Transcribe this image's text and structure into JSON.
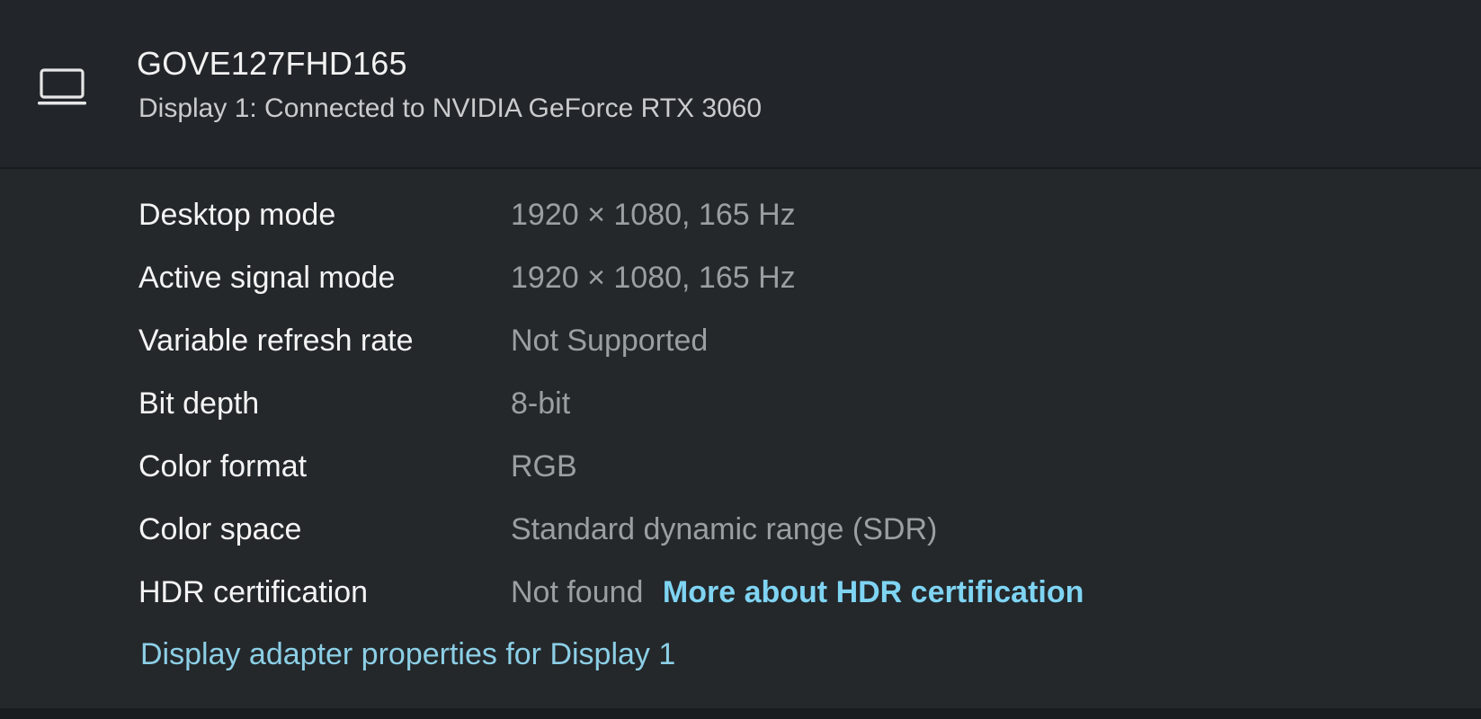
{
  "header": {
    "display_name": "GOVE127FHD165",
    "display_subtitle": "Display 1: Connected to NVIDIA GeForce RTX 3060",
    "icon": "laptop-monitor-icon"
  },
  "info_rows": [
    {
      "label": "Desktop mode",
      "value": "1920 × 1080, 165 Hz"
    },
    {
      "label": "Active signal mode",
      "value": "1920 × 1080, 165 Hz"
    },
    {
      "label": "Variable refresh rate",
      "value": "Not Supported"
    },
    {
      "label": "Bit depth",
      "value": "8-bit"
    },
    {
      "label": "Color format",
      "value": "RGB"
    },
    {
      "label": "Color space",
      "value": "Standard dynamic range (SDR)"
    },
    {
      "label": "HDR certification",
      "value": "Not found",
      "link": "More about HDR certification"
    }
  ],
  "adapter_link": "Display adapter properties for Display 1",
  "colors": {
    "background": "#24282b",
    "label_text": "#f4f4f4",
    "value_text": "#9b9fa2",
    "link_accent": "#7fd4f3"
  }
}
